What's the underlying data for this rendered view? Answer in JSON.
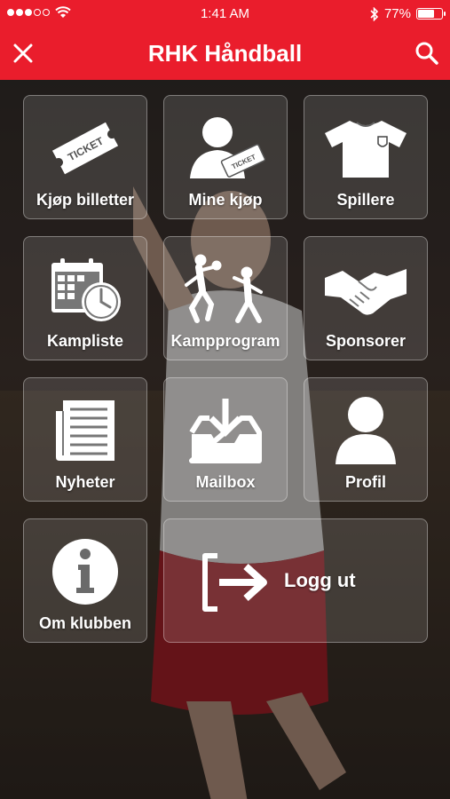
{
  "status_bar": {
    "time": "1:41 AM",
    "battery": "77%",
    "battery_level": 0.77
  },
  "nav": {
    "title": "RHK Håndball",
    "close_icon": "close-icon",
    "search_icon": "search-icon"
  },
  "menu": {
    "tiles": [
      {
        "label": "Kjøp billetter",
        "icon": "ticket-icon"
      },
      {
        "label": "Mine kjøp",
        "icon": "user-ticket-icon"
      },
      {
        "label": "Spillere",
        "icon": "jersey-icon"
      },
      {
        "label": "Kampliste",
        "icon": "calendar-clock-icon"
      },
      {
        "label": "Kampprogram",
        "icon": "handball-players-icon"
      },
      {
        "label": "Sponsorer",
        "icon": "handshake-icon"
      },
      {
        "label": "Nyheter",
        "icon": "newspaper-icon"
      },
      {
        "label": "Mailbox",
        "icon": "inbox-download-icon"
      },
      {
        "label": "Profil",
        "icon": "profile-icon"
      },
      {
        "label": "Om klubben",
        "icon": "info-icon"
      },
      {
        "label": "Logg ut",
        "icon": "logout-icon"
      }
    ]
  },
  "colors": {
    "brand": "#ea1d2c",
    "tile_bg": "rgba(255,255,255,0.13)"
  }
}
